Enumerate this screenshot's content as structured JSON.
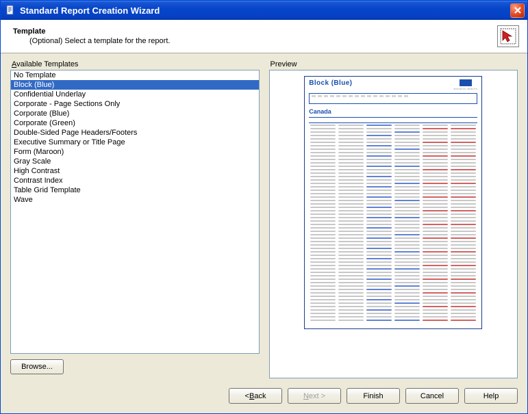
{
  "window": {
    "title": "Standard Report Creation Wizard"
  },
  "header": {
    "heading": "Template",
    "subheading": "(Optional) Select a template for the report."
  },
  "panes": {
    "left_label_pre": "A",
    "left_label_rest": "vailable Templates",
    "right_label": "Preview"
  },
  "templates": {
    "selected_index": 1,
    "items": [
      "No Template",
      "Block (Blue)",
      "Confidential Underlay",
      "Corporate - Page Sections Only",
      "Corporate (Blue)",
      "Corporate (Green)",
      "Double-Sided Page Headers/Footers",
      "Executive Summary or Title Page",
      "Form (Maroon)",
      "Gray Scale",
      "High Contrast",
      "Contrast Index",
      "Table Grid Template",
      "Wave"
    ]
  },
  "preview": {
    "title": "Block (Blue)",
    "country": "Canada",
    "columns": [
      "",
      "",
      "",
      "",
      "",
      ""
    ]
  },
  "buttons": {
    "browse": "Browse...",
    "back_lt": "< ",
    "back_ul": "B",
    "back_rest": "ack",
    "next_ul": "N",
    "next_rest": "ext >",
    "finish": "Finish",
    "cancel": "Cancel",
    "help": "Help"
  },
  "icons": {
    "app": "document-icon",
    "close": "close-icon",
    "header": "cursor-report-icon"
  },
  "colors": {
    "accent_blue": "#1b4fae",
    "selection": "#316ac5",
    "window_bg": "#ece9d8"
  }
}
